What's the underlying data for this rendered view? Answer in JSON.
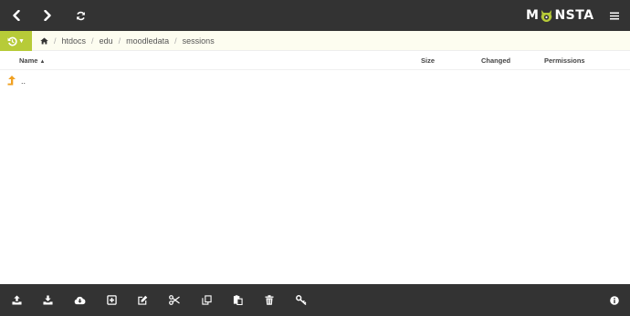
{
  "app": {
    "brand_before": "M",
    "brand_after": "NSTA",
    "brand_accent": "#b7cb38",
    "bar_color": "#333333"
  },
  "nav": {
    "back_icon": "chevron-left-icon",
    "forward_icon": "chevron-right-icon",
    "refresh_icon": "refresh-icon",
    "menu_icon": "hamburger-menu-icon"
  },
  "breadcrumb": {
    "history_icon": "history-icon",
    "home_icon": "home-icon",
    "items": [
      "htdocs",
      "edu",
      "moodledata",
      "sessions"
    ],
    "separator": "/"
  },
  "table": {
    "columns": {
      "name": "Name",
      "size": "Size",
      "changed": "Changed",
      "permissions": "Permissions"
    },
    "sort_indicator": "▲",
    "rows": [
      {
        "icon": "up-level-icon",
        "name": ".."
      }
    ]
  },
  "toolbar": {
    "buttons": [
      "upload-icon",
      "download-icon",
      "cloud-download-icon",
      "new-item-icon",
      "edit-icon",
      "cut-icon",
      "copy-icon",
      "paste-icon",
      "delete-icon",
      "key-icon",
      "info-icon"
    ]
  }
}
